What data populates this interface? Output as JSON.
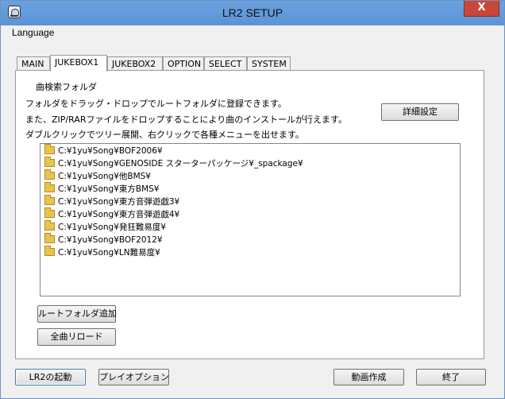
{
  "window": {
    "title": "LR2 SETUP",
    "close_glyph": "X"
  },
  "menu": {
    "language": "Language"
  },
  "tabs": [
    "MAIN",
    "JUKEBOX1",
    "JUKEBOX2",
    "OPTION",
    "SELECT",
    "SYSTEM"
  ],
  "active_tab": "JUKEBOX1",
  "jukebox1": {
    "section_label": "曲検索フォルダ",
    "descriptions": [
      "フォルダをドラッグ・ドロップでルートフォルダに登録できます。",
      "また、ZIP/RARファイルをドロップすることにより曲のインストールが行えます。",
      "ダブルクリックでツリー展開、右クリックで各種メニューを出せます。"
    ],
    "detail_settings_button": "詳細設定",
    "folders": [
      "C:¥1yu¥Song¥BOF2006¥",
      "C:¥1yu¥Song¥GENOSIDE スターターパッケージ¥_spackage¥",
      "C:¥1yu¥Song¥他BMS¥",
      "C:¥1yu¥Song¥東方BMS¥",
      "C:¥1yu¥Song¥東方音弾遊戯3¥",
      "C:¥1yu¥Song¥東方音弾遊戯4¥",
      "C:¥1yu¥Song¥発狂難易度¥",
      "C:¥1yu¥Song¥BOF2012¥",
      "C:¥1yu¥Song¥LN難易度¥"
    ],
    "add_root_button": "ルートフォルダ追加",
    "reload_all_button": "全曲リロード"
  },
  "footer": {
    "launch_button": "LR2の起動",
    "play_option_button": "プレイオプション",
    "movie_button": "動画作成",
    "exit_button": "終了"
  }
}
